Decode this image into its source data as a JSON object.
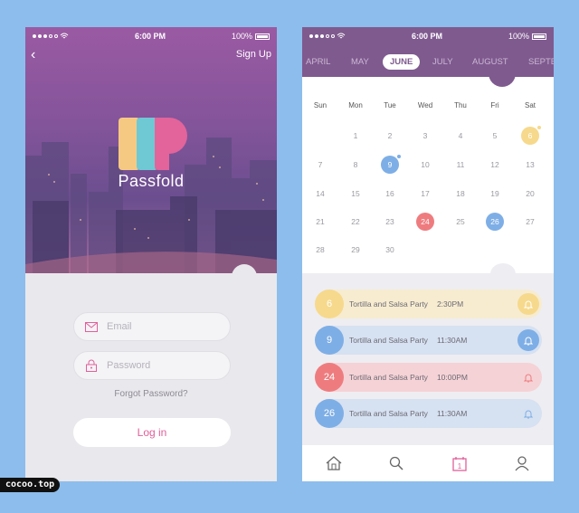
{
  "colors": {
    "background": "#8dbdec",
    "accent_pink": "#e0609a",
    "header_purple": "#7f5a8f",
    "event_yellow": "#f6d98c",
    "event_blue": "#7eaee6",
    "event_red": "#ee7c7f"
  },
  "login_screen": {
    "status": {
      "time": "6:00 PM",
      "battery": "100%"
    },
    "back_icon": "chevron-left-icon",
    "signup_label": "Sign Up",
    "brand_name": "Passfold",
    "email": {
      "placeholder": "Email",
      "icon": "envelope-icon"
    },
    "password": {
      "placeholder": "Password",
      "icon": "lock-icon"
    },
    "forgot_label": "Forgot Password?",
    "login_label": "Log in"
  },
  "calendar_screen": {
    "status": {
      "time": "6:00 PM",
      "battery": "100%"
    },
    "months": [
      "APRIL",
      "MAY",
      "JUNE",
      "JULY",
      "AUGUST",
      "SEPTE"
    ],
    "selected_month": "JUNE",
    "weekdays": [
      "Sun",
      "Mon",
      "Tue",
      "Wed",
      "Thu",
      "Fri",
      "Sat"
    ],
    "days": [
      [
        "",
        "1",
        "2",
        "3",
        "4",
        "5",
        "6"
      ],
      [
        "7",
        "8",
        "9",
        "10",
        "11",
        "12",
        "13"
      ],
      [
        "14",
        "15",
        "16",
        "17",
        "18",
        "19",
        "20"
      ],
      [
        "21",
        "22",
        "23",
        "24",
        "25",
        "26",
        "27"
      ],
      [
        "28",
        "29",
        "30",
        "",
        "",
        "",
        ""
      ]
    ],
    "highlighted_days": [
      {
        "day": "6",
        "color": "#f6d98c"
      },
      {
        "day": "9",
        "color": "#7eaee6"
      },
      {
        "day": "24",
        "color": "#ee7c7f"
      },
      {
        "day": "26",
        "color": "#7eaee6"
      }
    ],
    "events": [
      {
        "day": "6",
        "title": "Tortilla and Salsa Party",
        "time": "2:30PM",
        "color": "#f6d98c",
        "bg": "#f7ecd0"
      },
      {
        "day": "9",
        "title": "Tortilla and Salsa Party",
        "time": "11:30AM",
        "color": "#7eaee6",
        "bg": "#d6e1f1"
      },
      {
        "day": "24",
        "title": "Tortilla and Salsa Party",
        "time": "10:00PM",
        "color": "#ee7c7f",
        "bg": "#f5d2d6"
      },
      {
        "day": "26",
        "title": "Tortilla and Salsa Party",
        "time": "11:30AM",
        "color": "#7eaee6",
        "bg": "#d6e1f1"
      }
    ],
    "tabs": [
      "home-icon",
      "search-icon",
      "calendar-icon",
      "profile-icon"
    ],
    "tab_calendar_day": "1"
  },
  "watermark": "cocoo.top"
}
